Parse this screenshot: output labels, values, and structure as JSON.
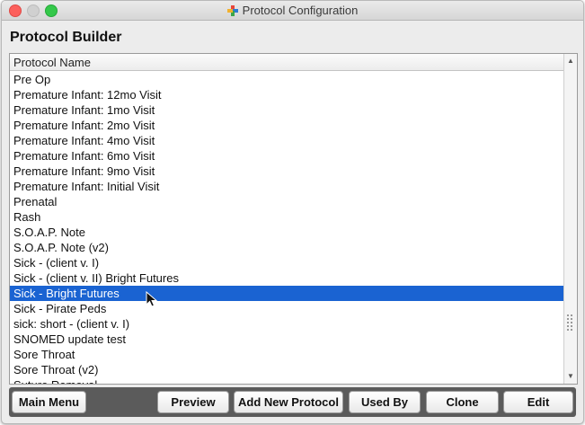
{
  "window": {
    "title": "Protocol Configuration"
  },
  "heading": "Protocol Builder",
  "list": {
    "column_header": "Protocol Name",
    "rows": [
      "Pre Op",
      "Premature Infant: 12mo Visit",
      "Premature Infant: 1mo Visit",
      "Premature Infant: 2mo Visit",
      "Premature Infant: 4mo Visit",
      "Premature Infant: 6mo Visit",
      "Premature Infant: 9mo Visit",
      "Premature Infant: Initial Visit",
      "Prenatal",
      "Rash",
      "S.O.A.P. Note",
      "S.O.A.P. Note (v2)",
      "Sick - (client v. I)",
      "Sick - (client v. II) Bright Futures",
      "Sick - Bright Futures",
      "Sick - Pirate Peds",
      "sick: short - (client v. I)",
      "SNOMED update test",
      "Sore Throat",
      "Sore Throat (v2)",
      "Suture Removal"
    ],
    "selected": "Sick - Bright Futures"
  },
  "buttons": {
    "main_menu": "Main Menu",
    "preview": "Preview",
    "add_new": "Add New Protocol",
    "used_by": "Used By",
    "clone": "Clone",
    "edit": "Edit"
  },
  "colors": {
    "selection": "#1a63d2",
    "toolbar": "#5b5b5b"
  },
  "icons": {
    "app": "plus-cross-icon",
    "cursor": "arrow-pointer-icon"
  }
}
